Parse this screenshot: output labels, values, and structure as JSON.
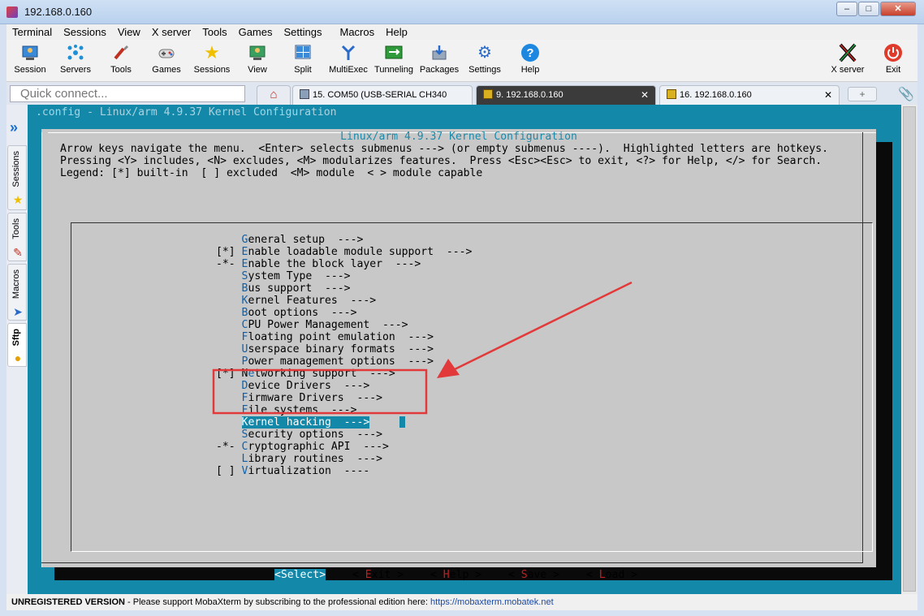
{
  "window": {
    "title": "192.168.0.160",
    "buttons": {
      "minimize": "–",
      "maximize": "□",
      "close": "✕"
    }
  },
  "menu": [
    "Terminal",
    "Sessions",
    "View",
    "X server",
    "Tools",
    "Games",
    "Settings",
    "Macros",
    "Help"
  ],
  "toolbar": [
    {
      "label": "Session",
      "icon": "session-icon"
    },
    {
      "label": "Servers",
      "icon": "servers-icon"
    },
    {
      "label": "Tools",
      "icon": "tools-icon"
    },
    {
      "label": "Games",
      "icon": "games-icon"
    },
    {
      "label": "Sessions",
      "icon": "star-icon"
    },
    {
      "label": "View",
      "icon": "view-icon"
    },
    {
      "label": "Split",
      "icon": "split-icon"
    },
    {
      "label": "MultiExec",
      "icon": "multiexec-icon"
    },
    {
      "label": "Tunneling",
      "icon": "tunneling-icon"
    },
    {
      "label": "Packages",
      "icon": "packages-icon"
    },
    {
      "label": "Settings",
      "icon": "settings-icon"
    },
    {
      "label": "Help",
      "icon": "help-icon"
    }
  ],
  "toolbar_right": [
    {
      "label": "X server",
      "icon": "xserver-icon"
    },
    {
      "label": "Exit",
      "icon": "power-icon"
    }
  ],
  "quick_connect": {
    "placeholder": "Quick connect..."
  },
  "tabs": [
    {
      "label": "15. COM50  (USB-SERIAL CH340",
      "active": false
    },
    {
      "label": "9. 192.168.0.160",
      "active": true,
      "close": "✕"
    },
    {
      "label": "16. 192.168.0.160",
      "active": false,
      "close": "✕"
    }
  ],
  "sidebar": [
    "Sessions",
    "Tools",
    "Macros",
    "Sftp"
  ],
  "terminal": {
    "config_title": ".config - Linux/arm 4.9.37 Kernel Configuration",
    "dialog_heading": "Linux/arm 4.9.37 Kernel Configuration",
    "instructions": [
      "Arrow keys navigate the menu.  <Enter> selects submenus ---> (or empty submenus ----).  Highlighted letters are hotkeys.",
      "Pressing <Y> includes, <N> excludes, <M> modularizes features.  Press <Esc><Esc> to exit, <?> for Help, </> for Search.",
      "Legend: [*] built-in  [ ] excluded  <M> module  < > module capable"
    ],
    "menu_items": [
      {
        "prefix": "    ",
        "hotkey": "G",
        "rest": "eneral setup  --->"
      },
      {
        "prefix": "[*] ",
        "hotkey": "E",
        "rest": "nable loadable module support  --->"
      },
      {
        "prefix": "-*- ",
        "hotkey": "E",
        "rest": "nable the block layer  --->"
      },
      {
        "prefix": "    ",
        "hotkey": "S",
        "rest": "ystem Type  --->"
      },
      {
        "prefix": "    ",
        "hotkey": "B",
        "rest": "us support  --->"
      },
      {
        "prefix": "    ",
        "hotkey": "K",
        "rest": "ernel Features  --->"
      },
      {
        "prefix": "    ",
        "hotkey": "B",
        "rest": "oot options  --->"
      },
      {
        "prefix": "    ",
        "hotkey": "C",
        "rest": "PU Power Management  --->"
      },
      {
        "prefix": "    ",
        "hotkey": "F",
        "rest": "loating point emulation  --->"
      },
      {
        "prefix": "    ",
        "hotkey": "U",
        "rest": "serspace binary formats  --->"
      },
      {
        "prefix": "    ",
        "hotkey": "P",
        "rest": "ower management options  --->"
      },
      {
        "prefix": "[*] ",
        "hotkey": "N",
        "rest": "etworking support  --->",
        "hotkey_index": 1
      },
      {
        "prefix": "    ",
        "hotkey": "D",
        "rest": "evice Drivers  --->"
      },
      {
        "prefix": "    ",
        "hotkey": "F",
        "rest": "irmware Drivers  --->"
      },
      {
        "prefix": "    ",
        "hotkey": "F",
        "rest": "ile systems  --->"
      },
      {
        "prefix": "    ",
        "hotkey": "K",
        "rest": "ernel hacking  --->",
        "selected": true
      },
      {
        "prefix": "    ",
        "hotkey": "S",
        "rest": "ecurity options  --->"
      },
      {
        "prefix": "-*- ",
        "hotkey": "C",
        "rest": "ryptographic API  --->"
      },
      {
        "prefix": "    ",
        "hotkey": "L",
        "rest": "ibrary routines  --->"
      },
      {
        "prefix": "[ ] ",
        "hotkey": "V",
        "rest": "irtualization  ----"
      }
    ],
    "buttons": [
      {
        "open": "<",
        "hotkey": "S",
        "rest": "elect",
        "close": ">",
        "selected": true
      },
      {
        "open": "< ",
        "hotkey": "E",
        "rest": "xit",
        "close": " >"
      },
      {
        "open": "< ",
        "hotkey": "H",
        "rest": "elp",
        "close": " >"
      },
      {
        "open": "< ",
        "hotkey": "S",
        "rest": "ave",
        "close": " >"
      },
      {
        "open": "< ",
        "hotkey": "L",
        "rest": "oad",
        "close": " >"
      }
    ]
  },
  "statusbar": {
    "version": "UNREGISTERED VERSION",
    "message": "  -  Please support MobaXterm by subscribing to the professional edition here:  ",
    "link": "https://mobaxterm.mobatek.net"
  },
  "colors": {
    "terminal_bg": "#1388a9",
    "dialog_bg": "#c8c8c8",
    "annotation": "#e23a3a",
    "hotkey": "#0f5fa8"
  }
}
